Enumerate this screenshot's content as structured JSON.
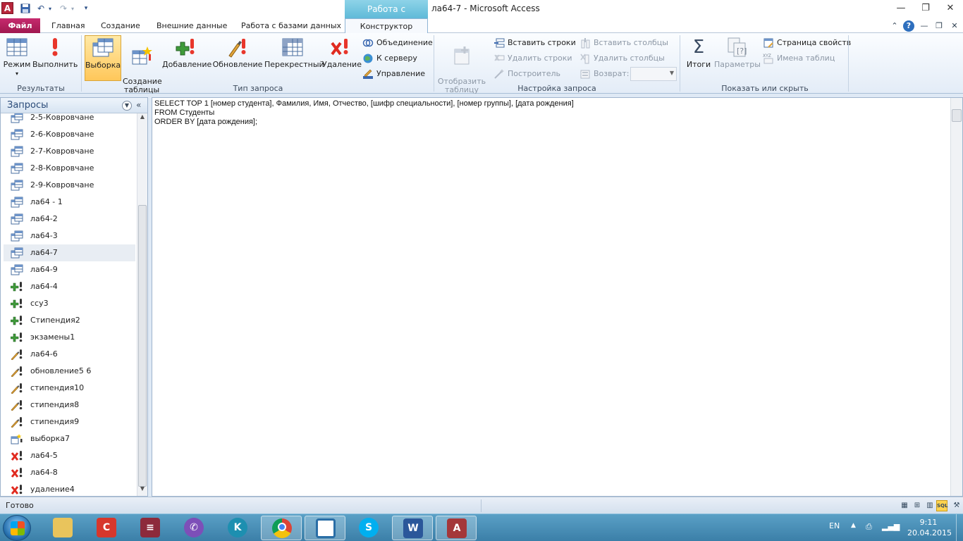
{
  "window": {
    "app_icon": "A",
    "context_tab_title": "Работа с запросами",
    "title": "ла64-7  -  Microsoft Access",
    "minimize": "—",
    "restore": "❐",
    "close": "✕"
  },
  "qat": {
    "save_icon": "save-icon",
    "undo_icon": "undo-icon",
    "redo_icon": "redo-icon",
    "customize": "▾"
  },
  "tabs": {
    "file": "Файл",
    "items": [
      "Главная",
      "Создание",
      "Внешние данные",
      "Работа с базами данных"
    ],
    "active": "Конструктор"
  },
  "ribbon": {
    "results": {
      "label": "Результаты",
      "mode": "Режим",
      "run": "Выполнить"
    },
    "query_type": {
      "label": "Тип запроса",
      "select": "Выборка",
      "make_table": "Создание\nтаблицы",
      "append": "Добавление",
      "update": "Обновление",
      "crosstab": "Перекрестный",
      "delete": "Удаление",
      "union": "Объединение",
      "pass_through": "К серверу",
      "data_definition": "Управление"
    },
    "query_setup": {
      "label": "Настройка запроса",
      "show_table": "Отобразить\nтаблицу",
      "insert_rows": "Вставить строки",
      "delete_rows": "Удалить строки",
      "builder": "Построитель",
      "insert_columns": "Вставить столбцы",
      "delete_columns": "Удалить столбцы",
      "return": "Возврат:",
      "return_value": ""
    },
    "show_hide": {
      "label": "Показать или скрыть",
      "totals": "Итоги",
      "parameters": "Параметры",
      "property_sheet": "Страница свойств",
      "table_names": "Имена таблиц"
    }
  },
  "nav": {
    "title": "Запросы",
    "items": [
      {
        "label": "2-5-Ковровчане",
        "icon": "select-query-icon"
      },
      {
        "label": "2-6-Ковровчане",
        "icon": "select-query-icon"
      },
      {
        "label": "2-7-Ковровчане",
        "icon": "select-query-icon"
      },
      {
        "label": "2-8-Ковровчане",
        "icon": "select-query-icon"
      },
      {
        "label": "2-9-Ковровчане",
        "icon": "select-query-icon"
      },
      {
        "label": "ла64 - 1",
        "icon": "select-query-icon"
      },
      {
        "label": "ла64-2",
        "icon": "select-query-icon"
      },
      {
        "label": "ла64-3",
        "icon": "select-query-icon"
      },
      {
        "label": "ла64-7",
        "icon": "select-query-icon",
        "selected": true
      },
      {
        "label": "ла64-9",
        "icon": "select-query-icon"
      },
      {
        "label": "ла64-4",
        "icon": "append-query-icon"
      },
      {
        "label": "ссу3",
        "icon": "append-query-icon"
      },
      {
        "label": "Стипендия2",
        "icon": "append-query-icon"
      },
      {
        "label": "экзамены1",
        "icon": "append-query-icon"
      },
      {
        "label": "ла64-6",
        "icon": "update-query-icon"
      },
      {
        "label": "обновление5 6",
        "icon": "update-query-icon"
      },
      {
        "label": "стипендия10",
        "icon": "update-query-icon"
      },
      {
        "label": "стипендия8",
        "icon": "update-query-icon"
      },
      {
        "label": "стипендия9",
        "icon": "update-query-icon"
      },
      {
        "label": "выборка7",
        "icon": "make-table-query-icon"
      },
      {
        "label": "ла64-5",
        "icon": "delete-query-icon"
      },
      {
        "label": "ла64-8",
        "icon": "delete-query-icon"
      },
      {
        "label": "удаление4",
        "icon": "delete-query-icon"
      }
    ]
  },
  "sql": {
    "text": "SELECT TOP 1 [номер студента], Фамилия, Имя, Отчество, [шифр специальности], [номер группы], [дата рождения]\nFROM Студенты\nORDER BY [дата рождения];"
  },
  "status": {
    "text": "Готово",
    "view_sql": "SQL"
  },
  "taskbar": {
    "lang": "EN",
    "time": "9:11",
    "date": "20.04.2015",
    "apps": [
      "file-explorer",
      "ccleaner",
      "winrar",
      "viber",
      "kaspersky",
      "chrome",
      "window-app",
      "skype",
      "word",
      "access"
    ]
  },
  "colors": {
    "file_tab": "#b8205e",
    "context_tab": "#6cc3de",
    "selected_button": "#ffc75a"
  }
}
